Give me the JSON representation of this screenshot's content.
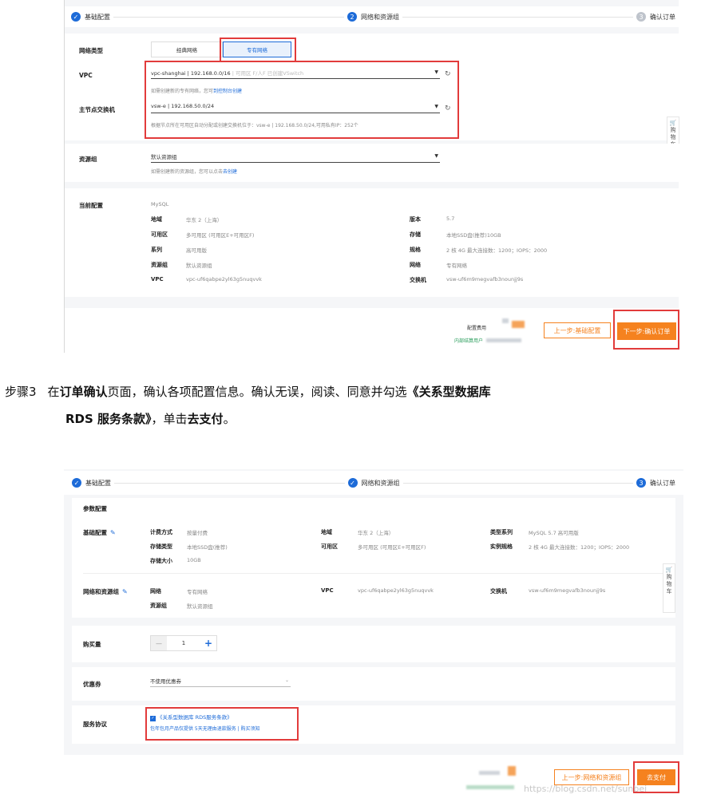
{
  "top": {
    "steps": [
      {
        "num": "✓",
        "label": "基础配置"
      },
      {
        "num": "2",
        "label": "网络和资源组"
      },
      {
        "num": "3",
        "label": "确认订单"
      }
    ],
    "network_type_label": "网络类型",
    "network_tabs": [
      "经典网络",
      "专有网络"
    ],
    "vpc_label": "VPC",
    "vpc_value": "vpc-shanghai | 192.168.0.0/16",
    "vpc_suffix": "| 可用区 F/人F 已创建VSwitch",
    "vpc_hint": "如需创建新的专有网络，您可",
    "vpc_hint_link": "到控制台创建",
    "switch_label": "主节点交换机",
    "switch_value": "vsw-e | 192.168.50.0/24",
    "switch_hint": "根据节点所在可用区自动分配或创建交换机位于：vsw-e | 192.168.50.0/24,可用私有IP：252个",
    "resgroup_label": "资源组",
    "resgroup_value": "默认资源组",
    "resgroup_hint": "如需创建新的资源组，您可以点击",
    "resgroup_hint_link": "去创建",
    "current_label": "当前配置",
    "engine": "MySQL",
    "left_items": [
      {
        "k": "地域",
        "v": "华东 2（上海）"
      },
      {
        "k": "可用区",
        "v": "多可用区 (可用区E+可用区F)"
      },
      {
        "k": "系列",
        "v": "高可用版"
      },
      {
        "k": "资源组",
        "v": "默认资源组"
      },
      {
        "k": "VPC",
        "v": "vpc-uf6qabpe2yl63g5nuqvvk"
      }
    ],
    "right_items": [
      {
        "k": "版本",
        "v": "5.7"
      },
      {
        "k": "存储",
        "v": "本地SSD盘(推荐)10GB"
      },
      {
        "k": "规格",
        "v": "2 核 4G 最大连接数：1200；IOPS：2000"
      },
      {
        "k": "网络",
        "v": "专有网络"
      },
      {
        "k": "交换机",
        "v": "vsw-uf6m9megvafb3nounjj9s"
      }
    ],
    "fee_label": "配置费用",
    "fee_sub": "内部结算用户",
    "prev_button": "上一步:基础配置",
    "next_button": "下一步:确认订单",
    "cart": [
      "购",
      "物",
      "车"
    ]
  },
  "instruction": {
    "step": "步骤3",
    "t1": "在",
    "b1": "订单确认",
    "t2": "页面，确认各项配置信息。确认无误，阅读、同意并勾选",
    "b2": "《关系型数据库",
    "b3": "RDS 服务条款》",
    "t3": "，单击",
    "b4": "去支付",
    "t4": "。"
  },
  "bottom": {
    "steps": [
      {
        "num": "✓",
        "label": "基础配置"
      },
      {
        "num": "✓",
        "label": "网络和资源组"
      },
      {
        "num": "3",
        "label": "确认订单"
      }
    ],
    "params_title": "参数配置",
    "basic_label": "基础配置",
    "basic_items": [
      {
        "k": "计费方式",
        "v": "按量付费"
      },
      {
        "k": "存储类型",
        "v": "本地SSD盘(推荐)"
      },
      {
        "k": "存储大小",
        "v": "10GB"
      }
    ],
    "region_items": [
      {
        "k": "地域",
        "v": "华东 2（上海）"
      },
      {
        "k": "可用区",
        "v": "多可用区 (可用区E+可用区F)"
      }
    ],
    "type_items": [
      {
        "k": "类型系列",
        "v": "MySQL 5.7 高可用版"
      },
      {
        "k": "实例规格",
        "v": "2 核 4G 最大连接数：1200；IOPS：2000"
      }
    ],
    "net_label": "网络和资源组",
    "net_items": [
      {
        "k": "网络",
        "v": "专有网络"
      },
      {
        "k": "资源组",
        "v": "默认资源组"
      }
    ],
    "vpc_k": "VPC",
    "vpc_v": "vpc-uf6qabpe2yl63g5nuqvvk",
    "switch_k": "交换机",
    "switch_v": "vsw-uf6m9megvafb3nounjj9s",
    "qty_label": "购买量",
    "qty_minus": "—",
    "qty_value": "1",
    "qty_plus": "+",
    "coupon_label": "优惠券",
    "coupon_value": "不使用优惠券",
    "agreement_label": "服务协议",
    "agreement_check": "《关系型数据库 RDS服务条款》",
    "agreement_sub": "包年包月产品仅提供 5天无理由退款服务 | 购买须知",
    "prev_button": "上一步:网络和资源组",
    "pay_button": "去支付",
    "cart": [
      "购",
      "物",
      "车"
    ],
    "watermark": "https://blog.csdn.net/sunbei"
  }
}
